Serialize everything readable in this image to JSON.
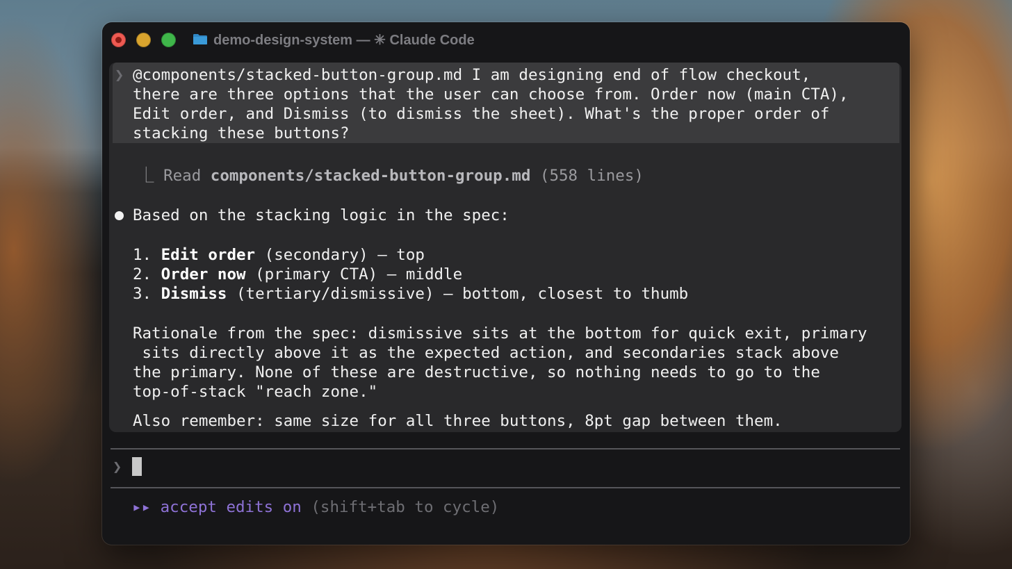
{
  "window": {
    "title": "demo-design-system — ✳ Claude Code"
  },
  "icons": {
    "folder": "folder-icon",
    "prompt_chevron": "❯",
    "tree_branch": "⎿",
    "bullet": "●",
    "mode_arrows": "▸▸"
  },
  "conversation": {
    "user_prompt_lines": [
      "@components/stacked-button-group.md I am designing end of flow checkout,",
      "there are three options that the user can choose from. Order now (main CTA),",
      "Edit order, and Dismiss (to dismiss the sheet). What's the proper order of",
      "stacking these buttons?"
    ],
    "tool_call": {
      "verb": "Read",
      "file": "components/stacked-button-group.md",
      "detail": "(558 lines)"
    },
    "response": {
      "intro": "Based on the stacking logic in the spec:",
      "list": [
        {
          "num": "1.",
          "label": "Edit order",
          "rest": " (secondary) — top"
        },
        {
          "num": "2.",
          "label": "Order now",
          "rest": " (primary CTA) — middle"
        },
        {
          "num": "3.",
          "label": "Dismiss",
          "rest": " (tertiary/dismissive) — bottom, closest to thumb"
        }
      ],
      "rationale_lines": [
        "Rationale from the spec: dismissive sits at the bottom for quick exit, primary",
        " sits directly above it as the expected action, and secondaries stack above",
        "the primary. None of these are destructive, so nothing needs to go to the",
        "top-of-stack \"reach zone.\""
      ],
      "reminder": "Also remember: same size for all three buttons, 8pt gap between them."
    }
  },
  "input": {
    "value": ""
  },
  "status": {
    "mode": "accept edits on",
    "hint": "(shift+tab to cycle)"
  },
  "colors": {
    "close": "#ee5a52",
    "minimize": "#d9a42e",
    "maximize": "#3fb64a",
    "folder": "#2f86c4",
    "mode_accent": "#8e72d6"
  }
}
